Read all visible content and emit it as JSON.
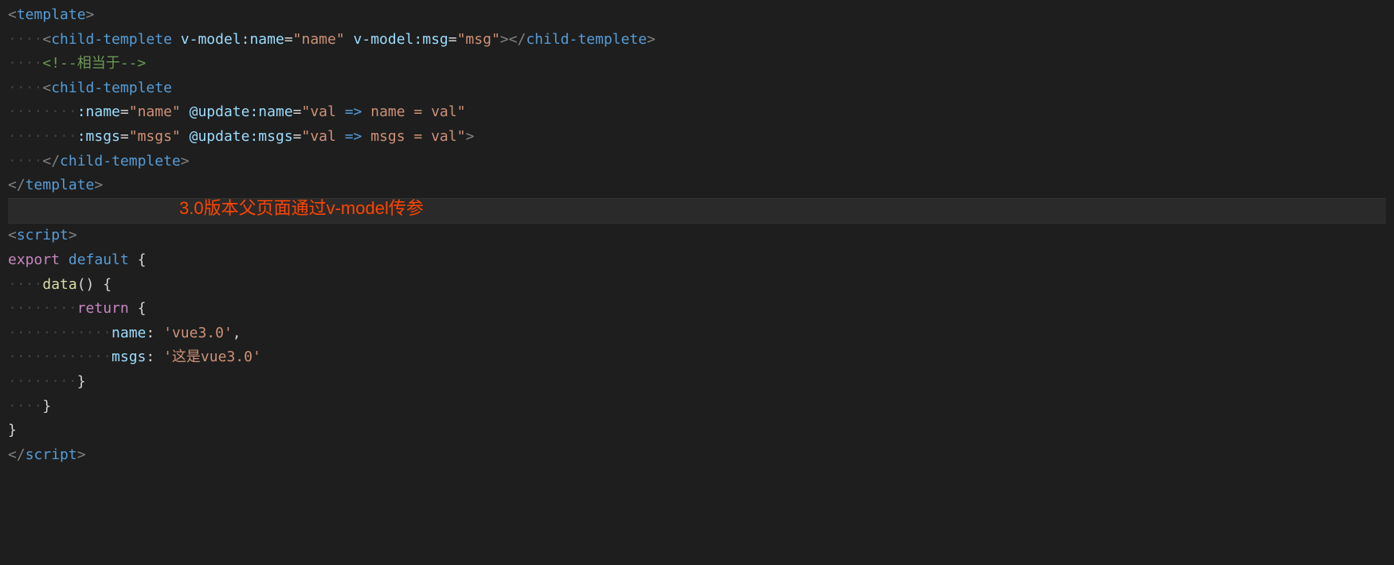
{
  "code": {
    "line1": {
      "open_bracket": "<",
      "tag": "template",
      "close_bracket": ">"
    },
    "line2": {
      "indent": "    ",
      "open_bracket": "<",
      "tag": "child-templete",
      "space1": " ",
      "attr1_name": "v-model:name",
      "eq1": "=",
      "attr1_val": "\"name\"",
      "space2": " ",
      "attr2_name": "v-model:msg",
      "eq2": "=",
      "attr2_val": "\"msg\"",
      "close1": ">",
      "close_open": "</",
      "close_tag": "child-templete",
      "close2": ">"
    },
    "line3": {
      "indent": "    ",
      "comment": "<!--相当于-->"
    },
    "line4": {
      "indent": "    ",
      "open_bracket": "<",
      "tag": "child-templete"
    },
    "line5": {
      "indent": "        ",
      "attr1_name": ":name",
      "eq1": "=",
      "attr1_val": "\"name\"",
      "space1": " ",
      "attr2_name": "@update:name",
      "eq2": "=",
      "attr2_val_open": "\"",
      "attr2_val_part1": "val ",
      "attr2_arrow": "=>",
      "attr2_val_part2": " name = val",
      "attr2_val_close": "\""
    },
    "line6": {
      "indent": "        ",
      "attr1_name": ":msgs",
      "eq1": "=",
      "attr1_val": "\"msgs\"",
      "space1": " ",
      "attr2_name": "@update:msgs",
      "eq2": "=",
      "attr2_val_open": "\"",
      "attr2_val_part1": "val ",
      "attr2_arrow": "=>",
      "attr2_val_part2": " msgs = val",
      "attr2_val_close": "\"",
      "close": ">"
    },
    "line7": {
      "indent": "    ",
      "close_open": "</",
      "tag": "child-templete",
      "close": ">"
    },
    "line8": {
      "close_open": "</",
      "tag": "template",
      "close": ">"
    },
    "line10": {
      "open_bracket": "<",
      "tag": "script",
      "close_bracket": ">"
    },
    "line11": {
      "export": "export",
      "space": " ",
      "default": "default",
      "space2": " ",
      "brace": "{"
    },
    "line12": {
      "indent": "    ",
      "func": "data",
      "parens": "()",
      "space": " ",
      "brace": "{"
    },
    "line13": {
      "indent": "        ",
      "return": "return",
      "space": " ",
      "brace": "{"
    },
    "line14": {
      "indent": "            ",
      "prop": "name",
      "colon": ":",
      "space": " ",
      "val": "'vue3.0'",
      "comma": ","
    },
    "line15": {
      "indent": "            ",
      "prop": "msgs",
      "colon": ":",
      "space": " ",
      "val": "'这是vue3.0'"
    },
    "line16": {
      "indent": "        ",
      "brace": "}"
    },
    "line17": {
      "indent": "    ",
      "brace": "}"
    },
    "line18": {
      "brace": "}"
    },
    "line19": {
      "close_open": "</",
      "tag": "script",
      "close": ">"
    }
  },
  "annotation": "3.0版本父页面通过v-model传参",
  "indent_dots": {
    "one": "····",
    "two": "········",
    "three": "············"
  }
}
